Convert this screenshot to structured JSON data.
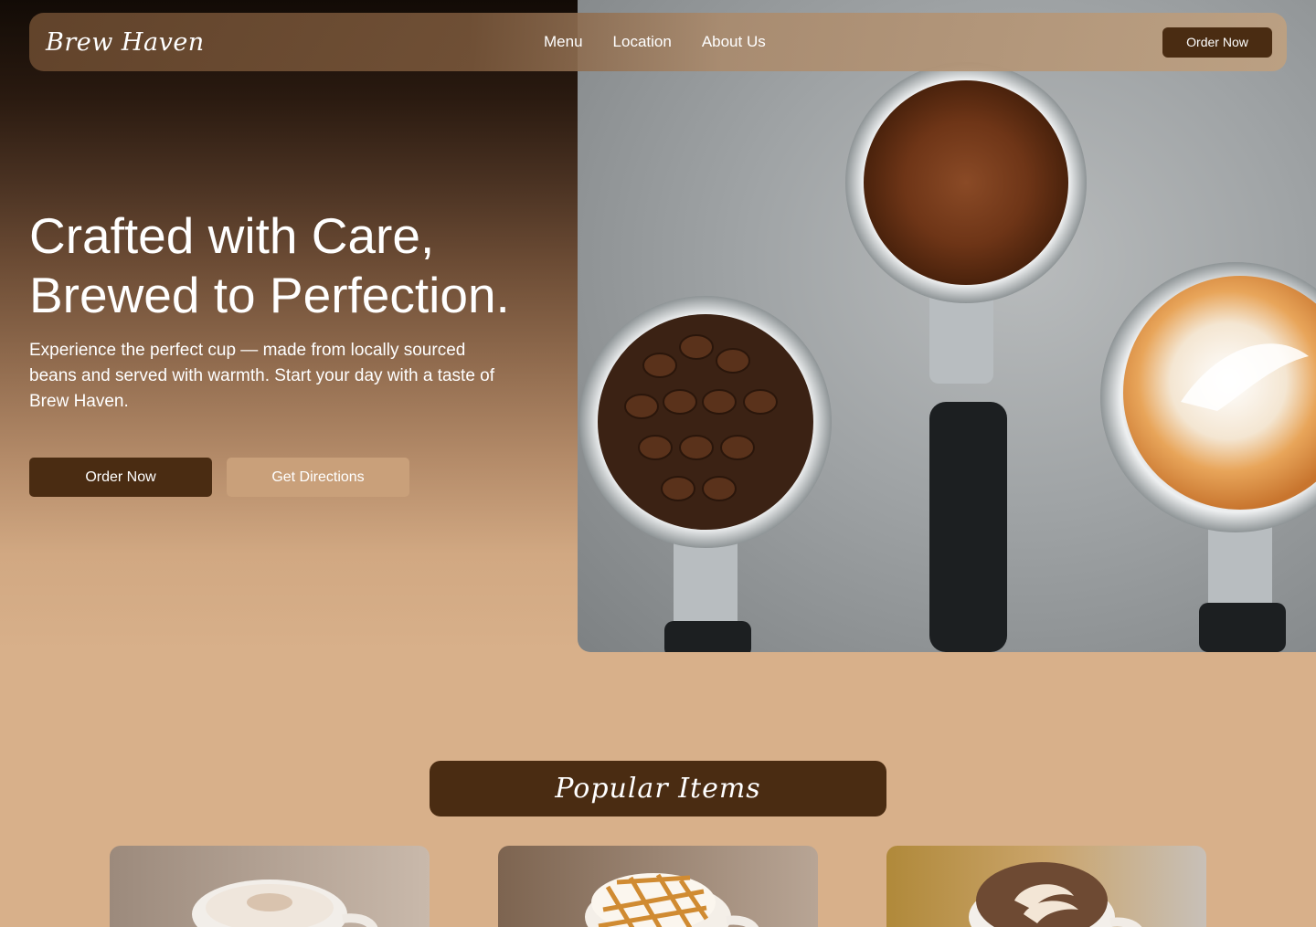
{
  "brand": {
    "name": "Brew Haven"
  },
  "nav": {
    "links": [
      "Menu",
      "Location",
      "About Us"
    ],
    "cta_label": "Order Now"
  },
  "hero": {
    "title_line1": "Crafted with Care,",
    "title_line2": "Brewed to Perfection.",
    "subtitle": "Experience the perfect cup — made from locally sourced beans and served with warmth. Start your day with a taste of Brew Haven.",
    "primary_label": "Order Now",
    "secondary_label": "Get Directions"
  },
  "popular": {
    "title": "Popular Items"
  },
  "colors": {
    "accent_dark": "#4a2c12",
    "background": "#d8b08a",
    "secondary_button": "#c9a07a"
  }
}
